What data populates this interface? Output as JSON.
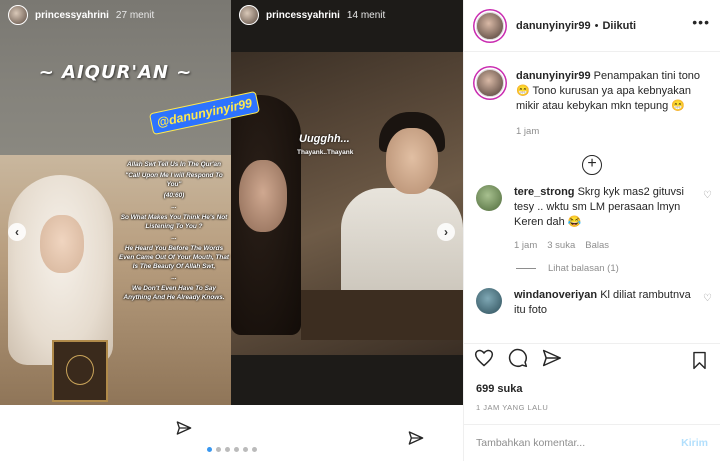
{
  "stories": [
    {
      "username": "princessyahrini",
      "time": "27 menit",
      "title_text": "~ AIQUR'AN ~",
      "quote": [
        "Allah Swt Tell Us In The Qur'an",
        "\"Call Upon Me I will Respond To You\"",
        "(40:60)",
        "...",
        "So What Makes You Think He's Not Listening To You ?",
        "...",
        "He Heard You Before The Words Even Came Out Of Your Mouth, That Is The Beauty Of Allah Swt,",
        "...",
        "We Don't Even Have To Say Anything And He Already Knows."
      ]
    },
    {
      "username": "princessyahrini",
      "time": "14 menit",
      "caption_main": "Uugghh...",
      "caption_sub": "Thayank..Thayank"
    }
  ],
  "watermark": "@danunyinyir99",
  "carousel": {
    "dot_count": 6,
    "active_index": 0
  },
  "header": {
    "username": "danunyinyir99",
    "separator": "•",
    "follow_label": "Diikuti",
    "more": "•••"
  },
  "caption": {
    "username": "danunyinyir99",
    "text": "Penampakan tini tono 😁 Tono kurusan ya apa kebnyakan mikir atau kebykan mkn tepung 😁",
    "time": "1 jam"
  },
  "load_more": "+",
  "comments": [
    {
      "username": "tere_strong",
      "text": "Skrg kyk mas2 gituvsi tesy .. wktu sm LM perasaan lmyn Keren dah 😂",
      "time": "1 jam",
      "likes": "3 suka",
      "reply": "Balas",
      "view_replies": "Lihat balasan (1)",
      "avatar_color": "#6b8a55"
    },
    {
      "username": "windanoveriyan",
      "text": "Kl diliat rambutnva itu foto",
      "avatar_color": "#3d6b7a"
    }
  ],
  "likes": "699 suka",
  "date": "1 JAM YANG LALU",
  "add_comment": {
    "placeholder": "Tambahkan komentar...",
    "post_label": "Kirim"
  },
  "icons": {
    "heart": "heart-icon",
    "comment": "comment-icon",
    "share": "share-icon",
    "bookmark": "bookmark-icon"
  }
}
